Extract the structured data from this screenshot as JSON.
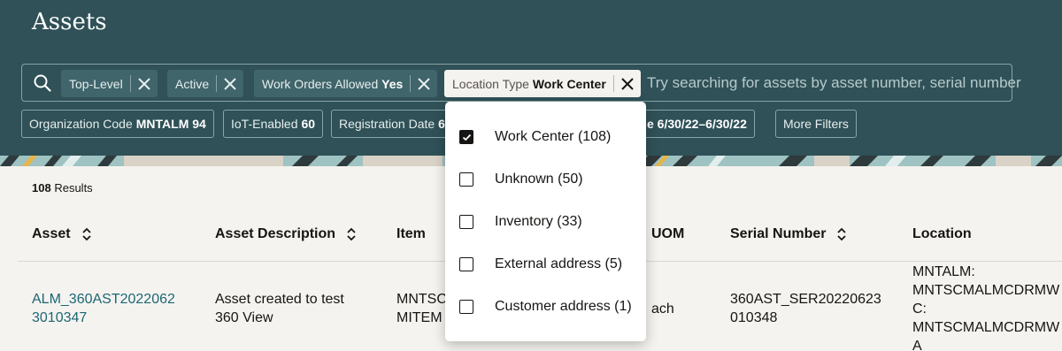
{
  "page": {
    "title": "Assets"
  },
  "search": {
    "placeholder": "Try searching for assets by asset number, serial number",
    "chips": [
      {
        "label": "Top-Level",
        "value": ""
      },
      {
        "label": "Active",
        "value": ""
      },
      {
        "label": "Work Orders Allowed",
        "value": "Yes"
      },
      {
        "label": "Location Type",
        "value": "Work Center"
      }
    ]
  },
  "filters": [
    {
      "label": "Organization Code",
      "value": "MNTALM 94"
    },
    {
      "label": "IoT-Enabled",
      "value": "60"
    },
    {
      "label": "Registration Date",
      "value": "6"
    },
    {
      "label": "",
      "value": "e 6/30/22–6/30/22"
    },
    {
      "label": "More Filters",
      "value": ""
    }
  ],
  "results": {
    "count": "108",
    "label": "Results"
  },
  "table": {
    "headers": [
      "Asset",
      "Asset Description",
      "Item",
      "UOM",
      "Serial Number",
      "Location"
    ],
    "row": {
      "asset": [
        "ALM_360AST2022062",
        "3010347"
      ],
      "description": [
        "Asset created to test",
        "360 View"
      ],
      "item": [
        "MNTSC",
        "MITEM"
      ],
      "uom": "ach",
      "serial": [
        "360AST_SER20220623",
        "010348"
      ],
      "location": [
        "MNTALM:",
        "MNTSCMALMCDRMW",
        "C:",
        "MNTSCMALMCDRMW",
        "A"
      ]
    }
  },
  "dropdown": {
    "options": [
      {
        "label": "Work Center (108)",
        "checked": true
      },
      {
        "label": "Unknown (50)",
        "checked": false
      },
      {
        "label": "Inventory (33)",
        "checked": false
      },
      {
        "label": "External address (5)",
        "checked": false
      },
      {
        "label": "Customer address (1)",
        "checked": false
      }
    ]
  },
  "colors": {
    "header_bg": "#2f5157",
    "link": "#1c6775",
    "page_bg": "#f5f3ef"
  }
}
